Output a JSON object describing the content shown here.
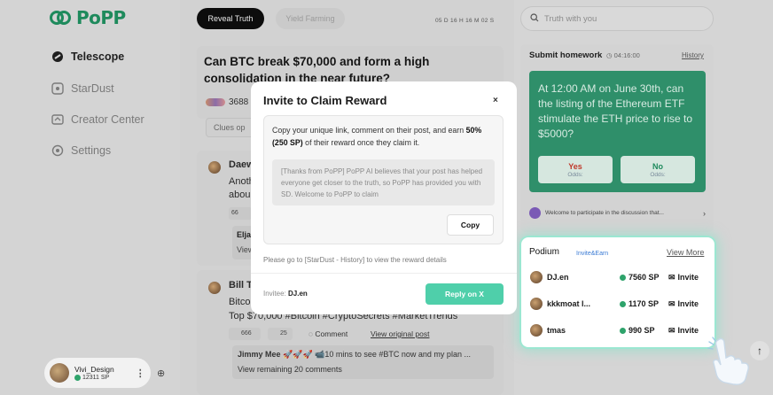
{
  "app": {
    "name": "PoPP",
    "brand_color": "#1e8a5c"
  },
  "sidebar": {
    "items": [
      {
        "label": "Telescope",
        "icon": "telescope-icon",
        "active": true
      },
      {
        "label": "StarDust",
        "icon": "stardust-icon",
        "active": false
      },
      {
        "label": "Creator Center",
        "icon": "creator-icon",
        "active": false
      },
      {
        "label": "Settings",
        "icon": "settings-icon",
        "active": false
      }
    ],
    "user": {
      "name": "Vivi_Design",
      "sp": "12311 SP"
    }
  },
  "main": {
    "tabs": [
      {
        "label": "Reveal Truth",
        "active": true
      },
      {
        "label": "Yield Farming",
        "active": false
      }
    ],
    "countdown": "05 D 16 H 16 M 02 S",
    "question": {
      "title": "Can BTC break $70,000 and form a high consolidation in the near future?",
      "participants": "3688",
      "clues_placeholder": "Clues op"
    },
    "posts": [
      {
        "author": "Daew",
        "line1": "Anoth",
        "line2": "abou",
        "count": "66",
        "reply_author": "Elja",
        "reply_line": "View"
      },
      {
        "author": "Bill Th",
        "line1": "Bitco",
        "line2": "Top $70,000 #Bitcoin #CryptoSecrets #MarketTrends",
        "count": "666",
        "reward": "25",
        "comment_label": "Comment",
        "view_original": "View original post",
        "reply_author": "Jimmy Mee",
        "reply_line": "🚀🚀🚀 📹10 mins to see #BTC now and my plan ...",
        "remaining": "View remaining 20 comments"
      }
    ]
  },
  "search": {
    "placeholder": "Truth with you"
  },
  "homework": {
    "title": "Submit homework",
    "time": "04:16:00",
    "history": "History",
    "question": "At 12:00 AM on June 30th, can the listing of the Ethereum ETF stimulate the ETH price to rise to $5000?",
    "yes_label": "Yes",
    "no_label": "No",
    "odds_label": "Odds:",
    "discussion": "Welcome to participate in the discussion that..."
  },
  "podium": {
    "title": "Podium",
    "invite_earn": "Invite&Earn",
    "view_more": "View More",
    "rows": [
      {
        "name": "DJ.en",
        "sp": "7560 SP",
        "action": "Invite"
      },
      {
        "name": "kkkmoat l...",
        "sp": "1170 SP",
        "action": "Invite"
      },
      {
        "name": "tmas",
        "sp": "990 SP",
        "action": "Invite"
      }
    ]
  },
  "modal": {
    "title": "Invite to Claim Reward",
    "close": "×",
    "info_pre": "Copy your unique link, comment on their post, and earn",
    "info_bold": "50% (250 SP)",
    "info_post": "of their reward once they claim it.",
    "quote": "[Thanks from PoPP] PoPP AI believes that your post has helped everyone get closer to the truth, so PoPP has provided you with SD. Welcome to PoPP to claim",
    "copy_label": "Copy",
    "note": "Please go to [StarDust - History] to view the reward details",
    "invitee_label": "Invitee:",
    "invitee_name": "DJ.en",
    "reply_label": "Reply on X"
  },
  "colors": {
    "accent": "#4fcfaa",
    "green_card": "#2f8f6a",
    "yes": "#c0392b",
    "no": "#1e8a5c"
  }
}
